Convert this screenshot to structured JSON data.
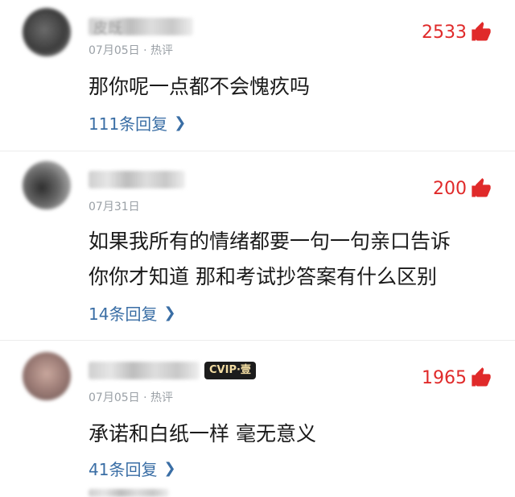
{
  "colors": {
    "accent_red": "#e02a2a",
    "reply_link": "#3a6ea5",
    "meta_gray": "#9aa0a6",
    "vip_badge_bg": "#1c1c1c",
    "vip_badge_text": "#f2dca2"
  },
  "comments": [
    {
      "username": "皮既",
      "date": "07月05日",
      "tag": "· 热评",
      "likes": "2533",
      "text_lines": [
        "那你呢一点都不会愧疚吗"
      ],
      "replies": "111条回复"
    },
    {
      "username": "",
      "date": "07月31日",
      "tag": "",
      "likes": "200",
      "text_lines": [
        "如果我所有的情绪都要一句一句亲口告诉",
        "你你才知道 那和考试抄答案有什么区别"
      ],
      "replies": "14条回复"
    },
    {
      "username": "",
      "vip_badge": "CVIP·壹",
      "date": "07月05日",
      "tag": "· 热评",
      "likes": "1965",
      "text_lines": [
        "承诺和白纸一样 毫无意义"
      ],
      "replies": "41条回复"
    }
  ]
}
